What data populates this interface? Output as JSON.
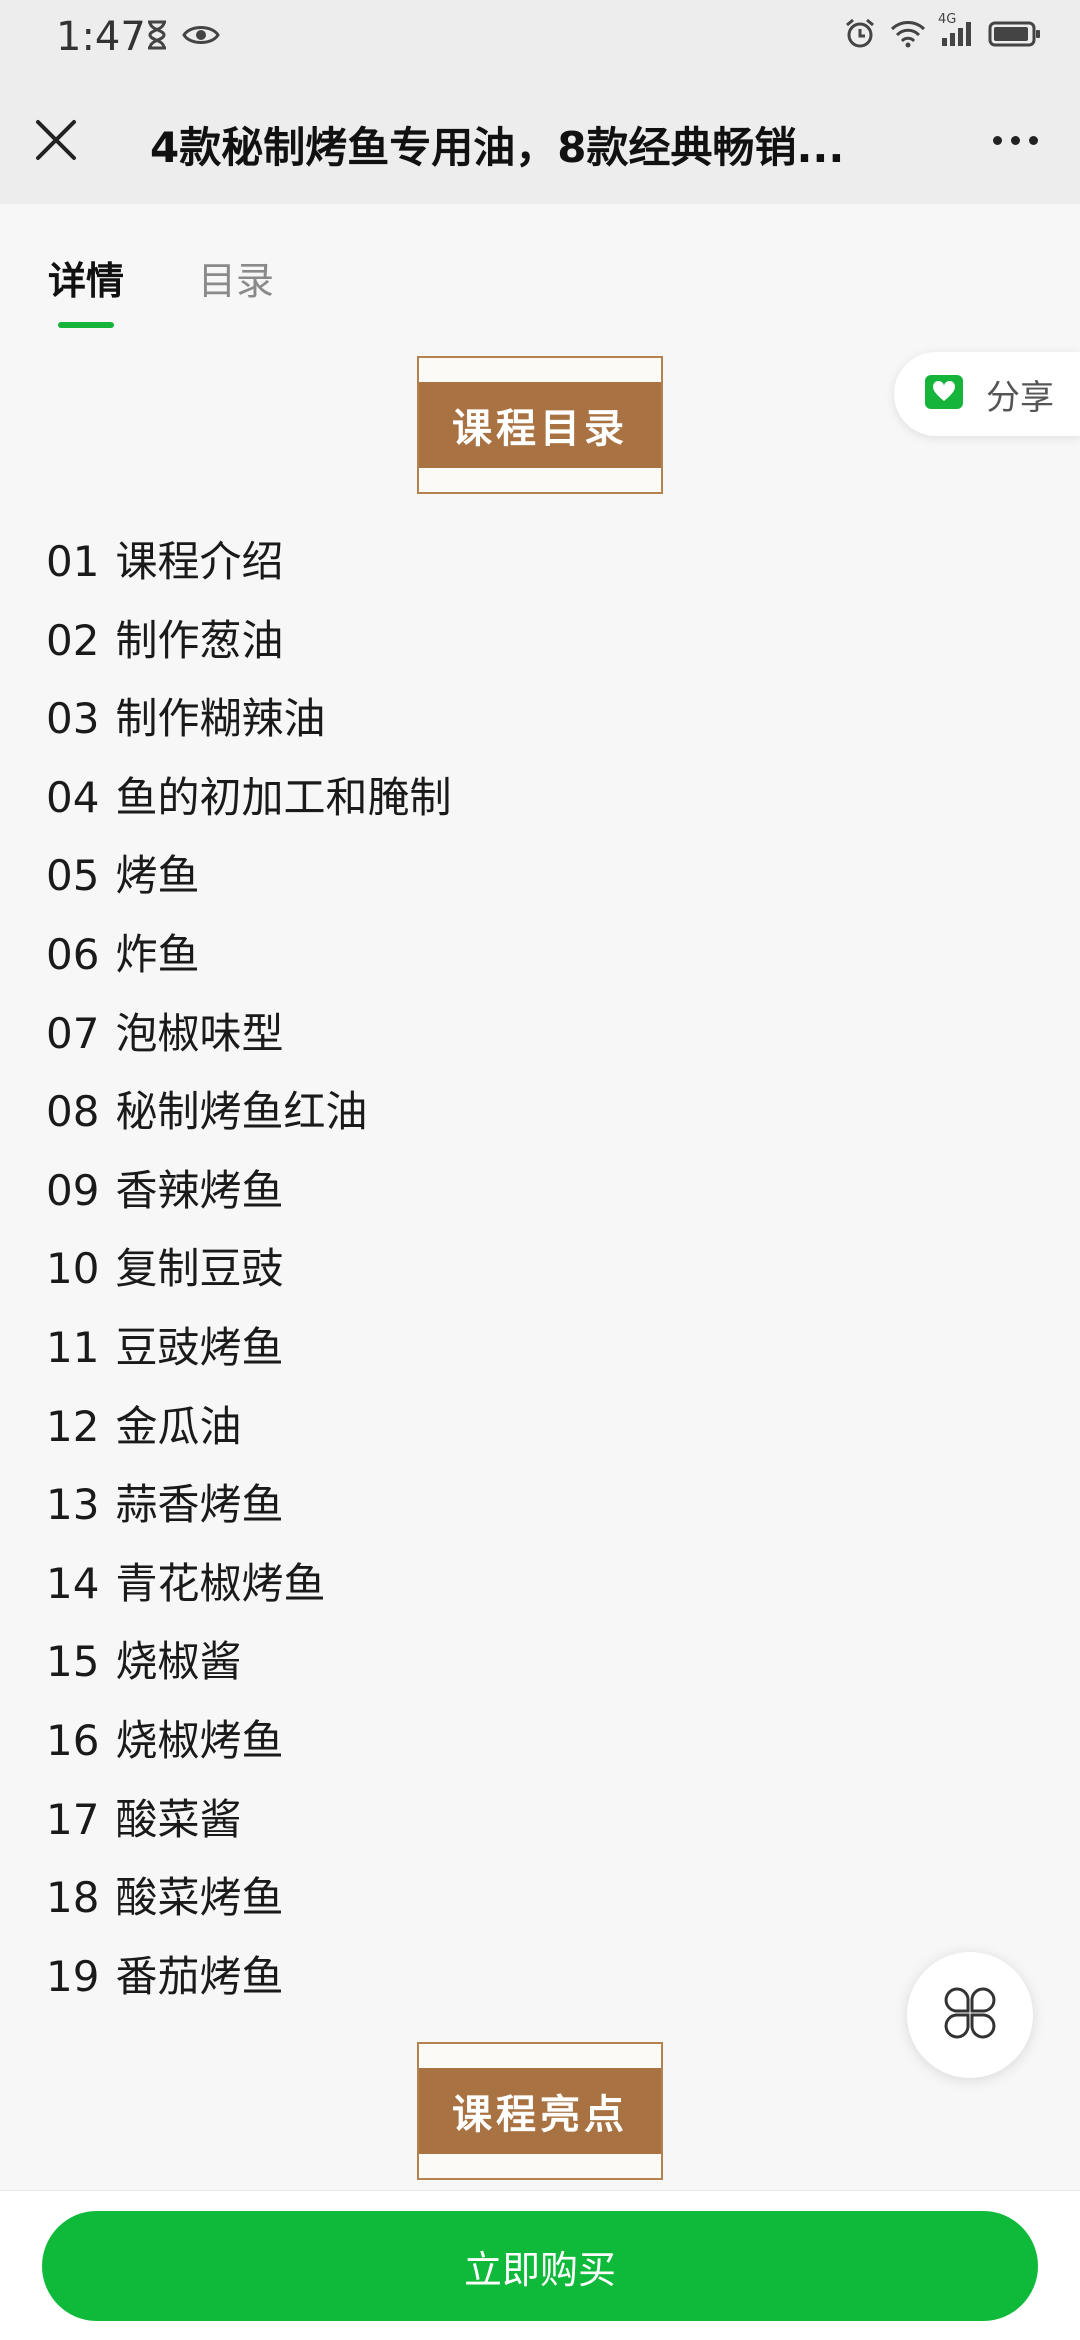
{
  "status_bar": {
    "time": "1:47",
    "network_type": "4G",
    "icons": [
      "hourglass-icon",
      "eye-icon",
      "alarm-icon",
      "wifi-icon",
      "signal-icon",
      "battery-icon"
    ]
  },
  "header": {
    "title": "4款秘制烤鱼专用油，8款经典畅销...",
    "close_icon": "close-icon",
    "more_icon": "more-icon"
  },
  "tabs": [
    {
      "label": "详情",
      "active": true
    },
    {
      "label": "目录",
      "active": false
    }
  ],
  "share": {
    "label": "分享",
    "icon": "share-icon"
  },
  "sections": {
    "catalog_title": "课程目录",
    "highlights_title": "课程亮点"
  },
  "lessons": [
    {
      "num": "01",
      "title": "课程介绍"
    },
    {
      "num": "02",
      "title": "制作葱油"
    },
    {
      "num": "03",
      "title": "制作糊辣油"
    },
    {
      "num": "04",
      "title": "鱼的初加工和腌制"
    },
    {
      "num": "05",
      "title": "烤鱼"
    },
    {
      "num": "06",
      "title": "炸鱼"
    },
    {
      "num": "07",
      "title": "泡椒味型"
    },
    {
      "num": "08",
      "title": "秘制烤鱼红油"
    },
    {
      "num": "09",
      "title": "香辣烤鱼"
    },
    {
      "num": "10",
      "title": "复制豆豉"
    },
    {
      "num": "11",
      "title": "豆豉烤鱼"
    },
    {
      "num": "12",
      "title": "金瓜油"
    },
    {
      "num": "13",
      "title": "蒜香烤鱼"
    },
    {
      "num": "14",
      "title": "青花椒烤鱼"
    },
    {
      "num": "15",
      "title": "烧椒酱"
    },
    {
      "num": "16",
      "title": "烧椒烤鱼"
    },
    {
      "num": "17",
      "title": "酸菜酱"
    },
    {
      "num": "18",
      "title": "酸菜烤鱼"
    },
    {
      "num": "19",
      "title": "番茄烤鱼"
    }
  ],
  "floating_menu": {
    "icon": "clover-menu-icon"
  },
  "bottom_bar": {
    "buy_label": "立即购买"
  },
  "colors": {
    "accent_green": "#0fb93a",
    "banner_brown": "#a87242",
    "header_bg": "#ededed",
    "content_bg": "#f7f7f7"
  }
}
